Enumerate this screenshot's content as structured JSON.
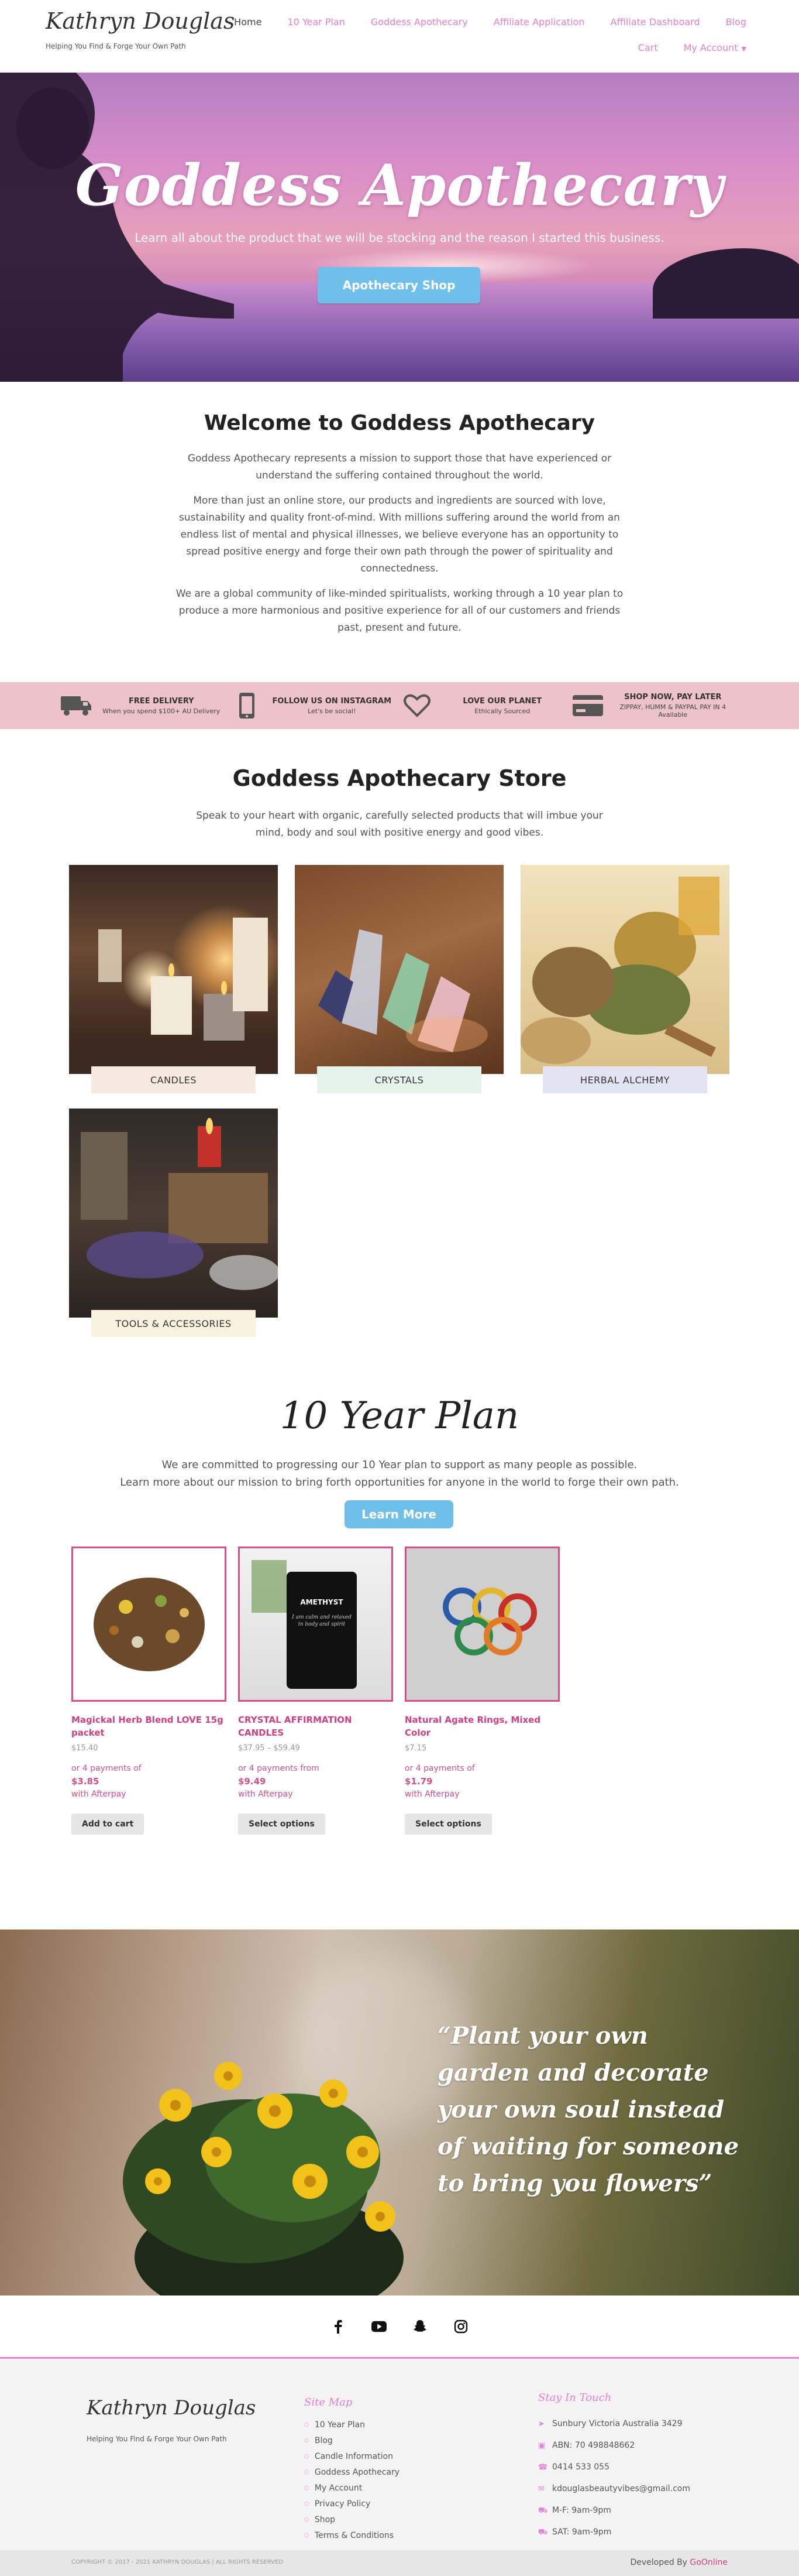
{
  "header": {
    "logo": "Kathryn Douglas",
    "tagline": "Helping You Find & Forge Your Own Path",
    "nav_row1": [
      {
        "label": "Home",
        "active": true
      },
      {
        "label": "10 Year Plan"
      },
      {
        "label": "Goddess Apothecary"
      },
      {
        "label": "Affiliate Application"
      },
      {
        "label": "Affiliate Dashboard"
      },
      {
        "label": "Blog"
      }
    ],
    "nav_cart": "Cart",
    "nav_account": "My Account"
  },
  "hero": {
    "title": "Goddess Apothecary",
    "subtitle": "Learn all about the product that we will be stocking and the reason I started this business.",
    "button": "Apothecary Shop"
  },
  "welcome": {
    "title": "Welcome to Goddess Apothecary",
    "p1": "Goddess Apothecary represents a mission to support those that have experienced or understand the suffering contained throughout the world.",
    "p2": "More than just an online store, our products and ingredients are sourced with love, sustainability and quality front-of-mind. With millions suffering around the world from an endless list of mental and physical illnesses, we believe everyone has an opportunity to spread positive energy and forge their own path through the power of spirituality and connectedness.",
    "p3": "We are a global community of like-minded spiritualists, working through a 10 year plan to produce a more harmonious and positive experience for all of our customers and friends past, present and future."
  },
  "features": [
    {
      "icon": "truck-icon",
      "title": "FREE DELIVERY",
      "sub": "When you spend $100+ AU Delivery"
    },
    {
      "icon": "phone-icon",
      "title": "FOLLOW US ON INSTAGRAM",
      "sub": "Let's be social!"
    },
    {
      "icon": "heart-icon",
      "title": "LOVE OUR PLANET",
      "sub": "Ethically Sourced"
    },
    {
      "icon": "credit-card-icon",
      "title": "SHOP NOW, PAY LATER",
      "sub": "ZIPPAY, HUMM & PAYPAL PAY IN 4 Available"
    }
  ],
  "store": {
    "title": "Goddess Apothecary Store",
    "intro": "Speak to your heart with organic, carefully selected products that will imbue your mind, body and soul with positive energy and good vibes.",
    "categories": [
      {
        "label": "CANDLES",
        "label_bg": "#f6e9df"
      },
      {
        "label": "CRYSTALS",
        "label_bg": "#e6f2ec"
      },
      {
        "label": "HERBAL ALCHEMY",
        "label_bg": "#e4e3f4"
      },
      {
        "label": "TOOLS & ACCESSORIES",
        "label_bg": "#f9f2de"
      }
    ]
  },
  "plan": {
    "title": "10 Year Plan",
    "line1": "We are committed to progressing our 10 Year plan to support as many people as possible.",
    "line2": "Learn more about our mission to bring forth opportunities for anyone in the world to forge their own path.",
    "button": "Learn More",
    "products": [
      {
        "name": "Magickal Herb Blend LOVE 15g packet",
        "price": "$15.40",
        "pay_prefix": "or 4 payments of",
        "pay_amount": "$3.85",
        "pay_suffix": "with Afterpay",
        "button": "Add to cart"
      },
      {
        "name": "CRYSTAL AFFIRMATION CANDLES",
        "price": "$37.95 – $59.49",
        "pay_prefix": "or 4 payments from",
        "pay_amount": "$9.49",
        "pay_suffix": "with Afterpay",
        "button": "Select options",
        "candle_text": "AMETHYST",
        "candle_sub": "I am calm and relaxed in body and spirit"
      },
      {
        "name": "Natural Agate Rings, Mixed Color",
        "price": "$7.15",
        "pay_prefix": "or 4 payments of",
        "pay_amount": "$1.79",
        "pay_suffix": "with Afterpay",
        "button": "Select options"
      }
    ]
  },
  "quote": {
    "text": "“Plant your own garden and decorate your own soul instead of waiting for someone to bring you flowers”"
  },
  "social": [
    "facebook-icon",
    "youtube-icon",
    "snapchat-icon",
    "instagram-icon"
  ],
  "footer": {
    "logo": "Kathryn Douglas",
    "tagline": "Helping You Find & Forge Your Own Path",
    "sitemap_title": "Site Map",
    "sitemap": [
      "10 Year Plan",
      "Blog",
      "Candle Information",
      "Goddess Apothecary",
      "My Account",
      "Privacy Policy",
      "Shop",
      "Terms & Conditions"
    ],
    "touch_title": "Stay In Touch",
    "touch": [
      {
        "icon": "location-icon",
        "text": "Sunbury Victoria Australia 3429"
      },
      {
        "icon": "id-card-icon",
        "text": "ABN: 70 498848662"
      },
      {
        "icon": "phone-icon",
        "text": "0414 533 055"
      },
      {
        "icon": "email-icon",
        "text": "kdouglasbeautyvibes@gmail.com"
      },
      {
        "icon": "car-icon",
        "text": "M-F: 9am-9pm"
      },
      {
        "icon": "car-icon",
        "text": "SAT: 9am-9pm"
      }
    ],
    "copyright": "COPYRIGHT © 2017 - 2021 KATHRYN DOUGLAS | ALL RIGHTS RESERVED",
    "developed_by": "Developed By",
    "developer": "GoOnline"
  },
  "colors": {
    "accent": "#e87fd0",
    "button": "#6ec0ea",
    "product_border": "#d64f8c",
    "feature_bar": "#edc2c8"
  }
}
